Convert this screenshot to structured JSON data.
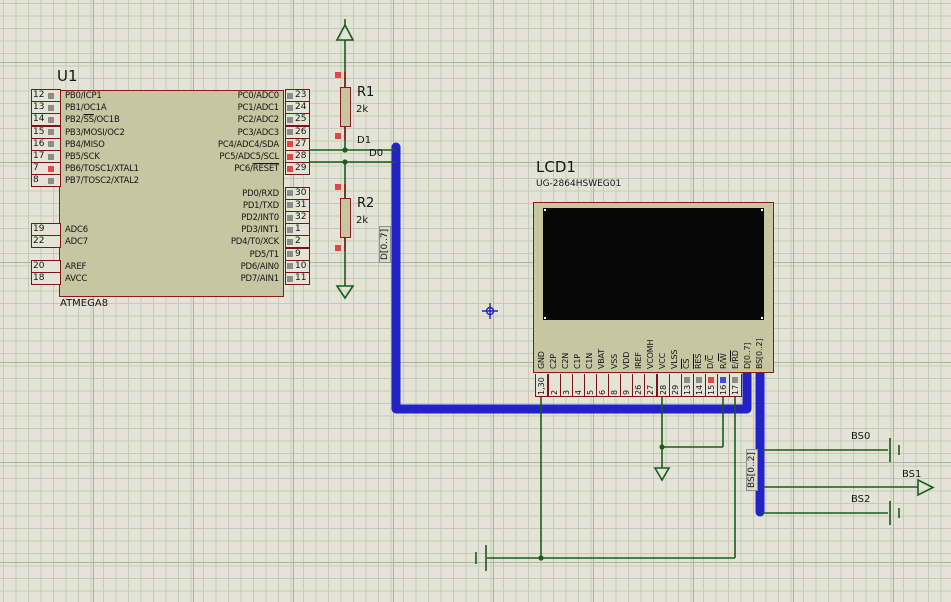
{
  "colors": {
    "grid_bg": "#e3e4d6",
    "grid_minor": "#c7cab8",
    "grid_major": "#adb1a0",
    "wire": "#1a5c1a",
    "bus": "#2222c8",
    "component_fill": "#c6c6a2",
    "component_outline": "#8b1b1b",
    "pin_red": "#e84545",
    "pin_gray": "#8c8c8c",
    "pin_blue": "#4848e8",
    "origin": "#2424bb"
  },
  "u1": {
    "ref": "U1",
    "value": "ATMEGA8",
    "left_pins": [
      {
        "num": "12",
        "row": 0,
        "square": "gray"
      },
      {
        "num": "13",
        "row": 1,
        "square": "gray"
      },
      {
        "num": "14",
        "row": 2,
        "square": "gray"
      },
      {
        "num": "15",
        "row": 3,
        "square": "gray"
      },
      {
        "num": "16",
        "row": 4,
        "square": "gray"
      },
      {
        "num": "17",
        "row": 5,
        "square": "gray"
      },
      {
        "num": "7",
        "row": 6,
        "square": "red"
      },
      {
        "num": "8",
        "row": 7,
        "square": "gray"
      },
      {
        "num": "19",
        "row": 11
      },
      {
        "num": "22",
        "row": 12
      },
      {
        "num": "20",
        "row": 14
      },
      {
        "num": "18",
        "row": 15
      }
    ],
    "right_pins": [
      {
        "num": "23",
        "row": 0,
        "square": "gray"
      },
      {
        "num": "24",
        "row": 1,
        "square": "gray"
      },
      {
        "num": "25",
        "row": 2,
        "square": "gray"
      },
      {
        "num": "26",
        "row": 3,
        "square": "gray"
      },
      {
        "num": "27",
        "row": 4,
        "square": "red"
      },
      {
        "num": "28",
        "row": 5,
        "square": "red"
      },
      {
        "num": "29",
        "row": 6,
        "square": "red"
      },
      {
        "num": "30",
        "row": 8,
        "square": "gray"
      },
      {
        "num": "31",
        "row": 9,
        "square": "gray"
      },
      {
        "num": "32",
        "row": 10,
        "square": "gray"
      },
      {
        "num": "1",
        "row": 11,
        "square": "gray"
      },
      {
        "num": "2",
        "row": 12,
        "square": "gray"
      },
      {
        "num": "9",
        "row": 13,
        "square": "gray"
      },
      {
        "num": "10",
        "row": 14,
        "square": "gray"
      },
      {
        "num": "11",
        "row": 15,
        "square": "gray"
      }
    ],
    "left_labels": [
      {
        "row": 0,
        "label": {
          "pre": "PB0/ICP1",
          "over": "",
          "post": ""
        }
      },
      {
        "row": 1,
        "label": {
          "pre": "PB1/OC1A",
          "over": "",
          "post": ""
        }
      },
      {
        "row": 2,
        "label": {
          "pre": "PB2/",
          "over": "SS",
          "post": "/OC1B"
        }
      },
      {
        "row": 3,
        "label": {
          "pre": "PB3/MOSI/OC2",
          "over": "",
          "post": ""
        }
      },
      {
        "row": 4,
        "label": {
          "pre": "PB4/MISO",
          "over": "",
          "post": ""
        }
      },
      {
        "row": 5,
        "label": {
          "pre": "PB5/SCK",
          "over": "",
          "post": ""
        }
      },
      {
        "row": 6,
        "label": {
          "pre": "PB6/TOSC1/XTAL1",
          "over": "",
          "post": ""
        }
      },
      {
        "row": 7,
        "label": {
          "pre": "PB7/TOSC2/XTAL2",
          "over": "",
          "post": ""
        }
      },
      {
        "row": 11,
        "label": {
          "pre": "ADC6",
          "over": "",
          "post": ""
        }
      },
      {
        "row": 12,
        "label": {
          "pre": "ADC7",
          "over": "",
          "post": ""
        }
      },
      {
        "row": 14,
        "label": {
          "pre": "AREF",
          "over": "",
          "post": ""
        }
      },
      {
        "row": 15,
        "label": {
          "pre": "AVCC",
          "over": "",
          "post": ""
        }
      }
    ],
    "right_labels": [
      {
        "row": 0,
        "label": {
          "pre": "PC0/ADC0",
          "over": "",
          "post": ""
        }
      },
      {
        "row": 1,
        "label": {
          "pre": "PC1/ADC1",
          "over": "",
          "post": ""
        }
      },
      {
        "row": 2,
        "label": {
          "pre": "PC2/ADC2",
          "over": "",
          "post": ""
        }
      },
      {
        "row": 3,
        "label": {
          "pre": "PC3/ADC3",
          "over": "",
          "post": ""
        }
      },
      {
        "row": 4,
        "label": {
          "pre": "PC4/ADC4/SDA",
          "over": "",
          "post": ""
        }
      },
      {
        "row": 5,
        "label": {
          "pre": "PC5/ADC5/SCL",
          "over": "",
          "post": ""
        }
      },
      {
        "row": 6,
        "label": {
          "pre": "PC6/",
          "over": "RESET",
          "post": ""
        }
      },
      {
        "row": 8,
        "label": {
          "pre": "PD0/RXD",
          "over": "",
          "post": ""
        }
      },
      {
        "row": 9,
        "label": {
          "pre": "PD1/TXD",
          "over": "",
          "post": ""
        }
      },
      {
        "row": 10,
        "label": {
          "pre": "PD2/INT0",
          "over": "",
          "post": ""
        }
      },
      {
        "row": 11,
        "label": {
          "pre": "PD3/INT1",
          "over": "",
          "post": ""
        }
      },
      {
        "row": 12,
        "label": {
          "pre": "PD4/T0/XCK",
          "over": "",
          "post": ""
        }
      },
      {
        "row": 13,
        "label": {
          "pre": "PD5/T1",
          "over": "",
          "post": ""
        }
      },
      {
        "row": 14,
        "label": {
          "pre": "PD6/AIN0",
          "over": "",
          "post": ""
        }
      },
      {
        "row": 15,
        "label": {
          "pre": "PD7/AIN1",
          "over": "",
          "post": ""
        }
      }
    ]
  },
  "r1": {
    "ref": "R1",
    "value": "2k"
  },
  "r2": {
    "ref": "R2",
    "value": "2k"
  },
  "lcd": {
    "ref": "LCD1",
    "part": "UG-2864HSWEG01",
    "pins": [
      {
        "name": {
          "pre": "GND",
          "over": "",
          "post": ""
        },
        "num": "1,30"
      },
      {
        "name": {
          "pre": "C2P",
          "over": "",
          "post": ""
        },
        "num": "2"
      },
      {
        "name": {
          "pre": "C2N",
          "over": "",
          "post": ""
        },
        "num": "3"
      },
      {
        "name": {
          "pre": "C1P",
          "over": "",
          "post": ""
        },
        "num": "4"
      },
      {
        "name": {
          "pre": "C1N",
          "over": "",
          "post": ""
        },
        "num": "5"
      },
      {
        "name": {
          "pre": "VBAT",
          "over": "",
          "post": ""
        },
        "num": "6"
      },
      {
        "name": {
          "pre": "VSS",
          "over": "",
          "post": ""
        },
        "num": "8"
      },
      {
        "name": {
          "pre": "VDD",
          "over": "",
          "post": ""
        },
        "num": "9"
      },
      {
        "name": {
          "pre": "IREF",
          "over": "",
          "post": ""
        },
        "num": "26"
      },
      {
        "name": {
          "pre": "VCOMH",
          "over": "",
          "post": ""
        },
        "num": "27"
      },
      {
        "name": {
          "pre": "VCC",
          "over": "",
          "post": ""
        },
        "num": "28"
      },
      {
        "name": {
          "pre": "VLSS",
          "over": "",
          "post": ""
        },
        "num": "29"
      },
      {
        "name": {
          "pre": "",
          "over": "CS",
          "post": ""
        },
        "num": "13",
        "square": "gray"
      },
      {
        "name": {
          "pre": "",
          "over": "RES",
          "post": ""
        },
        "num": "14",
        "square": "gray"
      },
      {
        "name": {
          "pre": "D/",
          "over": "C",
          "post": ""
        },
        "num": "15",
        "square": "red"
      },
      {
        "name": {
          "pre": "R/",
          "over": "W",
          "post": ""
        },
        "num": "16",
        "square": "blue"
      },
      {
        "name": {
          "pre": "E/",
          "over": "RD",
          "post": ""
        },
        "num": "17",
        "square": "gray"
      },
      {
        "name": {
          "pre": "D[0..7]",
          "over": "",
          "post": ""
        },
        "bus": true
      },
      {
        "name": {
          "pre": "BS[0..2]",
          "over": "",
          "post": ""
        },
        "bus": true
      }
    ]
  },
  "net_labels": {
    "d1": "D1",
    "d0": "D0",
    "d_bus": "D[0..7]",
    "bs_bus": "BS[0..2]",
    "bs0": "BS0",
    "bs1": "BS1",
    "bs2": "BS2"
  }
}
